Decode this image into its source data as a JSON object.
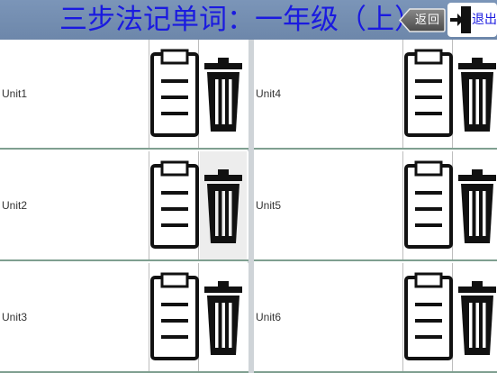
{
  "header": {
    "title": "三步法记单词：一年级（上）",
    "back_label": "返回",
    "exit_label": "退出"
  },
  "units": [
    {
      "label": "Unit1"
    },
    {
      "label": "Unit2"
    },
    {
      "label": "Unit3"
    },
    {
      "label": "Unit4"
    },
    {
      "label": "Unit5"
    },
    {
      "label": "Unit6"
    }
  ],
  "icons": {
    "notes": "clipboard-icon",
    "delete": "trash-icon",
    "back": "back-arrow-icon",
    "exit": "exit-door-icon"
  },
  "colors": {
    "header_bg": "#6d87aa",
    "title": "#1a1ae0",
    "row_divider": "#7f9f90"
  }
}
